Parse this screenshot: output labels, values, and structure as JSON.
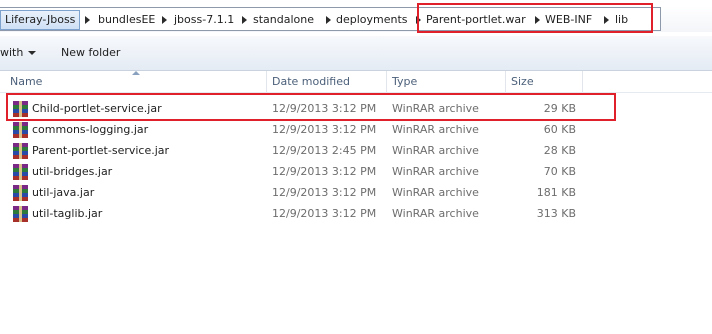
{
  "breadcrumb": {
    "items": [
      "Liferay-Jboss",
      "bundlesEE",
      "jboss-7.1.1",
      "standalone",
      "deployments",
      "Parent-portlet.war",
      "WEB-INF",
      "lib"
    ]
  },
  "toolbar": {
    "organize_label": "with",
    "new_folder_label": "New folder"
  },
  "columns": {
    "name": "Name",
    "date_modified": "Date modified",
    "type": "Type",
    "size": "Size"
  },
  "files": [
    {
      "name": "Child-portlet-service.jar",
      "date": "12/9/2013 3:12 PM",
      "type": "WinRAR archive",
      "size": "29 KB",
      "icon": "winrar-archive-icon"
    },
    {
      "name": "commons-logging.jar",
      "date": "12/9/2013 3:12 PM",
      "type": "WinRAR archive",
      "size": "60 KB",
      "icon": "winrar-archive-icon"
    },
    {
      "name": "Parent-portlet-service.jar",
      "date": "12/9/2013 2:45 PM",
      "type": "WinRAR archive",
      "size": "28 KB",
      "icon": "winrar-archive-icon"
    },
    {
      "name": "util-bridges.jar",
      "date": "12/9/2013 3:12 PM",
      "type": "WinRAR archive",
      "size": "70 KB",
      "icon": "winrar-archive-icon"
    },
    {
      "name": "util-java.jar",
      "date": "12/9/2013 3:12 PM",
      "type": "WinRAR archive",
      "size": "181 KB",
      "icon": "winrar-archive-icon"
    },
    {
      "name": "util-taglib.jar",
      "date": "12/9/2013 3:12 PM",
      "type": "WinRAR archive",
      "size": "313 KB",
      "icon": "winrar-archive-icon"
    }
  ],
  "colors": {
    "highlight": "#e0202a",
    "header_text": "#4c607a",
    "meta_text": "#6d6d6d"
  }
}
